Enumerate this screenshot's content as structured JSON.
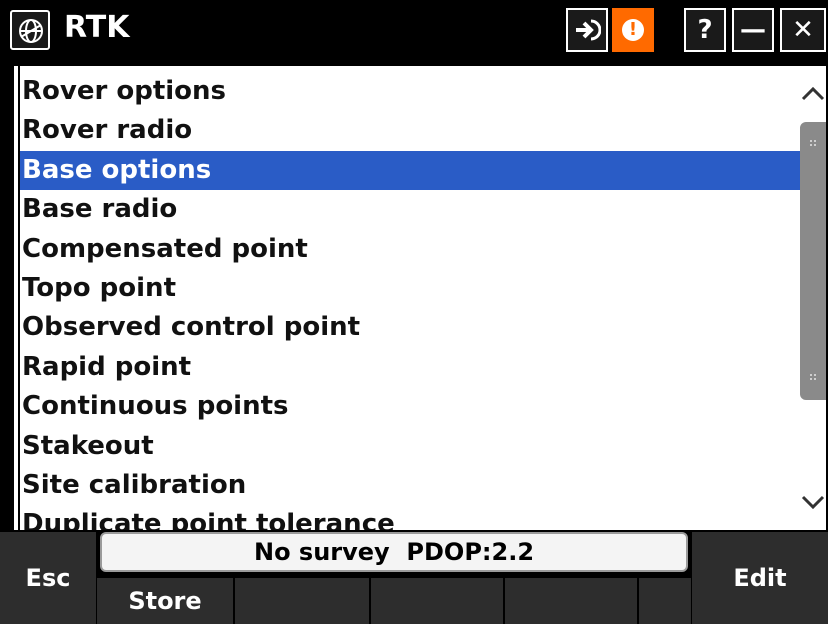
{
  "titlebar": {
    "title": "RTK",
    "app_icon": "trimble-globe-icon",
    "buttons": {
      "login": "arrow-right-icon",
      "warning": "exclamation-icon",
      "help": "?",
      "minimize": "—",
      "close": "✕"
    },
    "colors": {
      "warning": "#ff6a00"
    }
  },
  "list": {
    "items": [
      "Rover options",
      "Rover radio",
      "Base options",
      "Base radio",
      "Compensated point",
      "Topo point",
      "Observed control point",
      "Rapid point",
      "Continuous points",
      "Stakeout",
      "Site calibration",
      "Duplicate point tolerance"
    ],
    "selected_index": 2,
    "colors": {
      "selected": "#2a5cc6"
    }
  },
  "bottom": {
    "esc_label": "Esc",
    "edit_label": "Edit",
    "status": "No survey  PDOP:2.2",
    "fkeys": [
      "Store",
      "",
      "",
      "",
      ""
    ]
  }
}
